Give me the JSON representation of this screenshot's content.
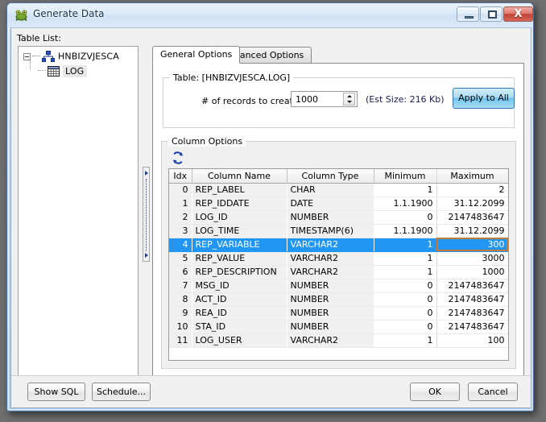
{
  "window": {
    "title": "Generate Data",
    "icon": "frog-icon",
    "controls": {
      "minimize": "minimize-icon",
      "maximize": "maximize-icon",
      "close": "X"
    }
  },
  "left_pane": {
    "label": "Table List:",
    "tree": {
      "schema": {
        "label": "HNBIZVJESCA",
        "icon": "schema-icon",
        "expanded": true
      },
      "table": {
        "label": "LOG",
        "icon": "table-icon",
        "selected": true
      }
    }
  },
  "tabs": [
    {
      "id": "general",
      "label": "General Options",
      "active": true
    },
    {
      "id": "advanced",
      "label": "Advanced Options",
      "active": false
    }
  ],
  "table_group": {
    "title": "Table: [HNBIZVJESCA.LOG]",
    "records_label": "# of records to create:",
    "records_value": "1000",
    "est_size": "(Est Size: 216 Kb)",
    "apply_to_all": "Apply to All"
  },
  "column_group": {
    "title": "Column Options",
    "refresh_icon": "refresh-icon",
    "headers": [
      "Idx",
      "Column Name",
      "Column Type",
      "Minimum",
      "Maximum"
    ],
    "rows": [
      {
        "idx": "0",
        "name": "REP_LABEL",
        "type": "CHAR",
        "min": "1",
        "max": "2",
        "selected": false
      },
      {
        "idx": "1",
        "name": "REP_IDDATE",
        "type": "DATE",
        "min": "1.1.1900",
        "max": "31.12.2099",
        "selected": false
      },
      {
        "idx": "2",
        "name": "LOG_ID",
        "type": "NUMBER",
        "min": "0",
        "max": "2147483647",
        "selected": false
      },
      {
        "idx": "3",
        "name": "LOG_TIME",
        "type": "TIMESTAMP(6)",
        "min": "1.1.1900",
        "max": "31.12.2099",
        "selected": false
      },
      {
        "idx": "4",
        "name": "REP_VARIABLE",
        "type": "VARCHAR2",
        "min": "1",
        "max": "300",
        "selected": true
      },
      {
        "idx": "5",
        "name": "REP_VALUE",
        "type": "VARCHAR2",
        "min": "1",
        "max": "3000",
        "selected": false
      },
      {
        "idx": "6",
        "name": "REP_DESCRIPTION",
        "type": "VARCHAR2",
        "min": "1",
        "max": "1000",
        "selected": false
      },
      {
        "idx": "7",
        "name": "MSG_ID",
        "type": "NUMBER",
        "min": "0",
        "max": "2147483647",
        "selected": false
      },
      {
        "idx": "8",
        "name": "ACT_ID",
        "type": "NUMBER",
        "min": "0",
        "max": "2147483647",
        "selected": false
      },
      {
        "idx": "9",
        "name": "REA_ID",
        "type": "NUMBER",
        "min": "0",
        "max": "2147483647",
        "selected": false
      },
      {
        "idx": "10",
        "name": "STA_ID",
        "type": "NUMBER",
        "min": "0",
        "max": "2147483647",
        "selected": false
      },
      {
        "idx": "11",
        "name": "LOG_USER",
        "type": "VARCHAR2",
        "min": "1",
        "max": "100",
        "selected": false
      }
    ]
  },
  "footer": {
    "show_sql": "Show SQL",
    "schedule": "Schedule...",
    "ok": "OK",
    "cancel": "Cancel"
  },
  "colors": {
    "selection": "#2196f3",
    "focus_cell_border": "#c07b3a",
    "accent_button": "#6fc4ef",
    "title_text": "#12314e"
  }
}
